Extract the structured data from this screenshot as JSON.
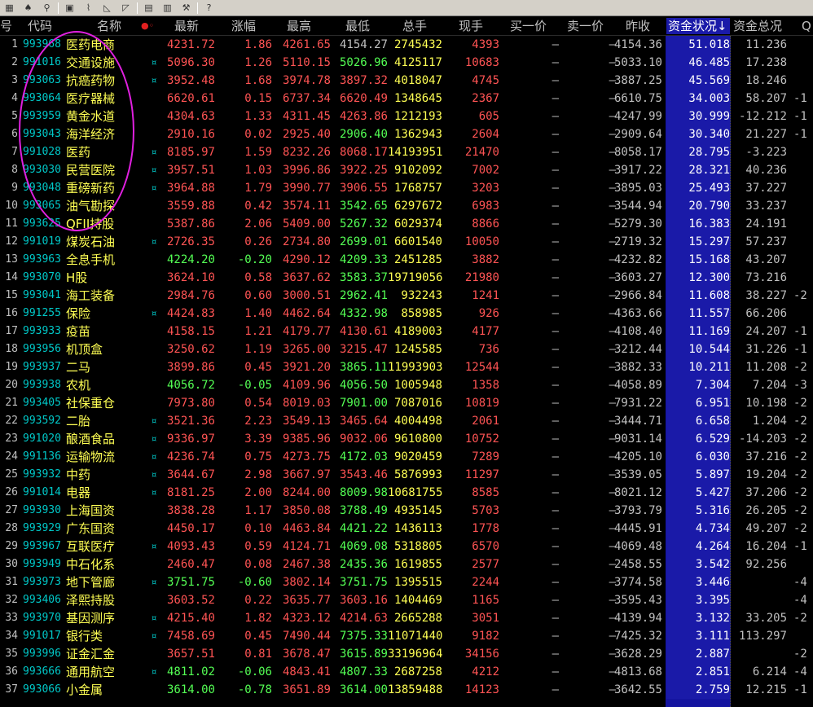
{
  "toolbar": {
    "buttons": [
      {
        "name": "layout-icon",
        "glyph": "▦"
      },
      {
        "name": "bell-icon",
        "glyph": "♠"
      },
      {
        "name": "link-icon",
        "glyph": "⚲"
      },
      {
        "name": "chart-red-icon",
        "glyph": "▣"
      },
      {
        "name": "line-chart-icon",
        "glyph": "⌇"
      },
      {
        "name": "ruler-icon",
        "glyph": "◺"
      },
      {
        "name": "angle-icon",
        "glyph": "◸"
      },
      {
        "name": "document-icon",
        "glyph": "▤"
      },
      {
        "name": "grid-icon",
        "glyph": "▥"
      },
      {
        "name": "tools-icon",
        "glyph": "⚒"
      },
      {
        "name": "help-icon",
        "glyph": "?"
      }
    ]
  },
  "header": {
    "idx": "号",
    "code": "代码",
    "name": "名称",
    "markers": "●◦",
    "latest": "最新",
    "chg": "涨幅",
    "high": "最高",
    "low": "最低",
    "vol": "总手",
    "cur": "现手",
    "bid": "买一价",
    "ask": "卖一价",
    "prev": "昨收",
    "fund": "资金状况↓",
    "total": "资金总况",
    "q": "Q"
  },
  "rows": [
    {
      "idx": "1",
      "code": "993968",
      "name": "医药电商",
      "mark": "",
      "latest": "4231.72",
      "chg": "1.86",
      "high": "4261.65",
      "low": "4154.27",
      "vol": "2745432",
      "cur": "4393",
      "bid": "—",
      "ask": "—",
      "prev": "4154.36",
      "fund": "51.018",
      "total": "11.236",
      "q": "",
      "dir": "up",
      "highDir": "up",
      "lowDir": "flat"
    },
    {
      "idx": "2",
      "code": "991016",
      "name": "交通设施",
      "mark": "¤",
      "latest": "5096.30",
      "chg": "1.26",
      "high": "5110.15",
      "low": "5026.96",
      "vol": "4125117",
      "cur": "10683",
      "bid": "—",
      "ask": "—",
      "prev": "5033.10",
      "fund": "46.485",
      "total": "17.238",
      "q": "",
      "dir": "up",
      "highDir": "up",
      "lowDir": "dn"
    },
    {
      "idx": "3",
      "code": "993063",
      "name": "抗癌药物",
      "mark": "¤",
      "latest": "3952.48",
      "chg": "1.68",
      "high": "3974.78",
      "low": "3897.32",
      "vol": "4018047",
      "cur": "4745",
      "bid": "—",
      "ask": "—",
      "prev": "3887.25",
      "fund": "45.569",
      "total": "18.246",
      "q": "",
      "dir": "up",
      "highDir": "up",
      "lowDir": "up"
    },
    {
      "idx": "4",
      "code": "993064",
      "name": "医疗器械",
      "mark": "",
      "latest": "6620.61",
      "chg": "0.15",
      "high": "6737.34",
      "low": "6620.49",
      "vol": "1348645",
      "cur": "2367",
      "bid": "—",
      "ask": "—",
      "prev": "6610.75",
      "fund": "34.003",
      "total": "58.207",
      "q": "-1",
      "dir": "up",
      "highDir": "up",
      "lowDir": "up"
    },
    {
      "idx": "5",
      "code": "993959",
      "name": "黄金水道",
      "mark": "",
      "latest": "4304.63",
      "chg": "1.33",
      "high": "4311.45",
      "low": "4263.86",
      "vol": "1212193",
      "cur": "605",
      "bid": "—",
      "ask": "—",
      "prev": "4247.99",
      "fund": "30.999",
      "total": "-12.212",
      "q": "-1",
      "dir": "up",
      "highDir": "up",
      "lowDir": "up"
    },
    {
      "idx": "6",
      "code": "993043",
      "name": "海洋经济",
      "mark": "",
      "latest": "2910.16",
      "chg": "0.02",
      "high": "2925.40",
      "low": "2906.40",
      "vol": "1362943",
      "cur": "2604",
      "bid": "—",
      "ask": "—",
      "prev": "2909.64",
      "fund": "30.340",
      "total": "21.227",
      "q": "-1",
      "dir": "up",
      "highDir": "up",
      "lowDir": "dn"
    },
    {
      "idx": "7",
      "code": "991028",
      "name": "医药",
      "mark": "¤",
      "latest": "8185.97",
      "chg": "1.59",
      "high": "8232.26",
      "low": "8068.17",
      "vol": "14193951",
      "cur": "21470",
      "bid": "—",
      "ask": "—",
      "prev": "8058.17",
      "fund": "28.795",
      "total": "-3.223",
      "q": "",
      "dir": "up",
      "highDir": "up",
      "lowDir": "up"
    },
    {
      "idx": "8",
      "code": "993030",
      "name": "民营医院",
      "mark": "¤",
      "latest": "3957.51",
      "chg": "1.03",
      "high": "3996.86",
      "low": "3922.25",
      "vol": "9102092",
      "cur": "7002",
      "bid": "—",
      "ask": "—",
      "prev": "3917.22",
      "fund": "28.321",
      "total": "40.236",
      "q": "",
      "dir": "up",
      "highDir": "up",
      "lowDir": "up"
    },
    {
      "idx": "9",
      "code": "993048",
      "name": "重磅新药",
      "mark": "¤",
      "latest": "3964.88",
      "chg": "1.79",
      "high": "3990.77",
      "low": "3906.55",
      "vol": "1768757",
      "cur": "3203",
      "bid": "—",
      "ask": "—",
      "prev": "3895.03",
      "fund": "25.493",
      "total": "37.227",
      "q": "",
      "dir": "up",
      "highDir": "up",
      "lowDir": "up"
    },
    {
      "idx": "10",
      "code": "993065",
      "name": "油气勘探",
      "mark": "",
      "latest": "3559.88",
      "chg": "0.42",
      "high": "3574.11",
      "low": "3542.65",
      "vol": "6297672",
      "cur": "6983",
      "bid": "—",
      "ask": "—",
      "prev": "3544.94",
      "fund": "20.790",
      "total": "33.237",
      "q": "",
      "dir": "up",
      "highDir": "up",
      "lowDir": "dn"
    },
    {
      "idx": "11",
      "code": "993625",
      "name": "QFII持股",
      "mark": "",
      "latest": "5387.86",
      "chg": "2.06",
      "high": "5409.00",
      "low": "5267.32",
      "vol": "6029374",
      "cur": "8866",
      "bid": "—",
      "ask": "—",
      "prev": "5279.30",
      "fund": "16.383",
      "total": "24.191",
      "q": "",
      "dir": "up",
      "highDir": "up",
      "lowDir": "dn"
    },
    {
      "idx": "12",
      "code": "991019",
      "name": "煤炭石油",
      "mark": "¤",
      "latest": "2726.35",
      "chg": "0.26",
      "high": "2734.80",
      "low": "2699.01",
      "vol": "6601540",
      "cur": "10050",
      "bid": "—",
      "ask": "—",
      "prev": "2719.32",
      "fund": "15.297",
      "total": "57.237",
      "q": "",
      "dir": "up",
      "highDir": "up",
      "lowDir": "dn"
    },
    {
      "idx": "13",
      "code": "993963",
      "name": "全息手机",
      "mark": "",
      "latest": "4224.20",
      "chg": "-0.20",
      "high": "4290.12",
      "low": "4209.33",
      "vol": "2451285",
      "cur": "3882",
      "bid": "—",
      "ask": "—",
      "prev": "4232.82",
      "fund": "15.168",
      "total": "43.207",
      "q": "",
      "dir": "dn",
      "highDir": "up",
      "lowDir": "dn"
    },
    {
      "idx": "14",
      "code": "993070",
      "name": "H股",
      "mark": "",
      "latest": "3624.10",
      "chg": "0.58",
      "high": "3637.62",
      "low": "3583.37",
      "vol": "19719056",
      "cur": "21980",
      "bid": "—",
      "ask": "—",
      "prev": "3603.27",
      "fund": "12.300",
      "total": "73.216",
      "q": "",
      "dir": "up",
      "highDir": "up",
      "lowDir": "dn"
    },
    {
      "idx": "15",
      "code": "993041",
      "name": "海工装备",
      "mark": "",
      "latest": "2984.76",
      "chg": "0.60",
      "high": "3000.51",
      "low": "2962.41",
      "vol": "932243",
      "cur": "1241",
      "bid": "—",
      "ask": "—",
      "prev": "2966.84",
      "fund": "11.608",
      "total": "38.227",
      "q": "-2",
      "dir": "up",
      "highDir": "up",
      "lowDir": "dn"
    },
    {
      "idx": "16",
      "code": "991255",
      "name": "保险",
      "mark": "¤",
      "latest": "4424.83",
      "chg": "1.40",
      "high": "4462.64",
      "low": "4332.98",
      "vol": "858985",
      "cur": "926",
      "bid": "—",
      "ask": "—",
      "prev": "4363.66",
      "fund": "11.557",
      "total": "66.206",
      "q": "",
      "dir": "up",
      "highDir": "up",
      "lowDir": "dn"
    },
    {
      "idx": "17",
      "code": "993933",
      "name": "疫苗",
      "mark": "",
      "latest": "4158.15",
      "chg": "1.21",
      "high": "4179.77",
      "low": "4130.61",
      "vol": "4189003",
      "cur": "4177",
      "bid": "—",
      "ask": "—",
      "prev": "4108.40",
      "fund": "11.169",
      "total": "24.207",
      "q": "-1",
      "dir": "up",
      "highDir": "up",
      "lowDir": "up"
    },
    {
      "idx": "18",
      "code": "993956",
      "name": "机顶盒",
      "mark": "",
      "latest": "3250.62",
      "chg": "1.19",
      "high": "3265.00",
      "low": "3215.47",
      "vol": "1245585",
      "cur": "736",
      "bid": "—",
      "ask": "—",
      "prev": "3212.44",
      "fund": "10.544",
      "total": "31.226",
      "q": "-1",
      "dir": "up",
      "highDir": "up",
      "lowDir": "up"
    },
    {
      "idx": "19",
      "code": "993937",
      "name": "二马",
      "mark": "",
      "latest": "3899.86",
      "chg": "0.45",
      "high": "3921.20",
      "low": "3865.11",
      "vol": "11993903",
      "cur": "12544",
      "bid": "—",
      "ask": "—",
      "prev": "3882.33",
      "fund": "10.211",
      "total": "11.208",
      "q": "-2",
      "dir": "up",
      "highDir": "up",
      "lowDir": "dn"
    },
    {
      "idx": "20",
      "code": "993938",
      "name": "农机",
      "mark": "",
      "latest": "4056.72",
      "chg": "-0.05",
      "high": "4109.96",
      "low": "4056.50",
      "vol": "1005948",
      "cur": "1358",
      "bid": "—",
      "ask": "—",
      "prev": "4058.89",
      "fund": "7.304",
      "total": "7.204",
      "q": "-3",
      "dir": "dn",
      "highDir": "up",
      "lowDir": "dn"
    },
    {
      "idx": "21",
      "code": "993405",
      "name": "社保重仓",
      "mark": "",
      "latest": "7973.80",
      "chg": "0.54",
      "high": "8019.03",
      "low": "7901.00",
      "vol": "7087016",
      "cur": "10819",
      "bid": "—",
      "ask": "—",
      "prev": "7931.22",
      "fund": "6.951",
      "total": "10.198",
      "q": "-2",
      "dir": "up",
      "highDir": "up",
      "lowDir": "dn"
    },
    {
      "idx": "22",
      "code": "993592",
      "name": "二胎",
      "mark": "¤",
      "latest": "3521.36",
      "chg": "2.23",
      "high": "3549.13",
      "low": "3465.64",
      "vol": "4004498",
      "cur": "2061",
      "bid": "—",
      "ask": "—",
      "prev": "3444.71",
      "fund": "6.658",
      "total": "1.204",
      "q": "-2",
      "dir": "up",
      "highDir": "up",
      "lowDir": "up"
    },
    {
      "idx": "23",
      "code": "991020",
      "name": "酿酒食品",
      "mark": "¤",
      "latest": "9336.97",
      "chg": "3.39",
      "high": "9385.96",
      "low": "9032.06",
      "vol": "9610800",
      "cur": "10752",
      "bid": "—",
      "ask": "—",
      "prev": "9031.14",
      "fund": "6.529",
      "total": "-14.203",
      "q": "-2",
      "dir": "up",
      "highDir": "up",
      "lowDir": "up"
    },
    {
      "idx": "24",
      "code": "991136",
      "name": "运输物流",
      "mark": "¤",
      "latest": "4236.74",
      "chg": "0.75",
      "high": "4273.75",
      "low": "4172.03",
      "vol": "9020459",
      "cur": "7289",
      "bid": "—",
      "ask": "—",
      "prev": "4205.10",
      "fund": "6.030",
      "total": "37.216",
      "q": "-2",
      "dir": "up",
      "highDir": "up",
      "lowDir": "dn"
    },
    {
      "idx": "25",
      "code": "993932",
      "name": "中药",
      "mark": "¤",
      "latest": "3644.67",
      "chg": "2.98",
      "high": "3667.97",
      "low": "3543.46",
      "vol": "5876993",
      "cur": "11297",
      "bid": "—",
      "ask": "—",
      "prev": "3539.05",
      "fund": "5.897",
      "total": "19.204",
      "q": "-2",
      "dir": "up",
      "highDir": "up",
      "lowDir": "up"
    },
    {
      "idx": "26",
      "code": "991014",
      "name": "电器",
      "mark": "¤",
      "latest": "8181.25",
      "chg": "2.00",
      "high": "8244.00",
      "low": "8009.98",
      "vol": "10681755",
      "cur": "8585",
      "bid": "—",
      "ask": "—",
      "prev": "8021.12",
      "fund": "5.427",
      "total": "37.206",
      "q": "-2",
      "dir": "up",
      "highDir": "up",
      "lowDir": "dn"
    },
    {
      "idx": "27",
      "code": "993930",
      "name": "上海国资",
      "mark": "",
      "latest": "3838.28",
      "chg": "1.17",
      "high": "3850.08",
      "low": "3788.49",
      "vol": "4935145",
      "cur": "5703",
      "bid": "—",
      "ask": "—",
      "prev": "3793.79",
      "fund": "5.316",
      "total": "26.205",
      "q": "-2",
      "dir": "up",
      "highDir": "up",
      "lowDir": "dn"
    },
    {
      "idx": "28",
      "code": "993929",
      "name": "广东国资",
      "mark": "",
      "latest": "4450.17",
      "chg": "0.10",
      "high": "4463.84",
      "low": "4421.22",
      "vol": "1436113",
      "cur": "1778",
      "bid": "—",
      "ask": "—",
      "prev": "4445.91",
      "fund": "4.734",
      "total": "49.207",
      "q": "-2",
      "dir": "up",
      "highDir": "up",
      "lowDir": "dn"
    },
    {
      "idx": "29",
      "code": "993967",
      "name": "互联医疗",
      "mark": "¤",
      "latest": "4093.43",
      "chg": "0.59",
      "high": "4124.71",
      "low": "4069.08",
      "vol": "5318805",
      "cur": "6570",
      "bid": "—",
      "ask": "—",
      "prev": "4069.48",
      "fund": "4.264",
      "total": "16.204",
      "q": "-1",
      "dir": "up",
      "highDir": "up",
      "lowDir": "dn"
    },
    {
      "idx": "30",
      "code": "993949",
      "name": "中石化系",
      "mark": "",
      "latest": "2460.47",
      "chg": "0.08",
      "high": "2467.38",
      "low": "2435.36",
      "vol": "1619855",
      "cur": "2577",
      "bid": "—",
      "ask": "—",
      "prev": "2458.55",
      "fund": "3.542",
      "total": "92.256",
      "q": "",
      "dir": "up",
      "highDir": "up",
      "lowDir": "dn"
    },
    {
      "idx": "31",
      "code": "993973",
      "name": "地下管廊",
      "mark": "¤",
      "latest": "3751.75",
      "chg": "-0.60",
      "high": "3802.14",
      "low": "3751.75",
      "vol": "1395515",
      "cur": "2244",
      "bid": "—",
      "ask": "—",
      "prev": "3774.58",
      "fund": "3.446",
      "total": "",
      "q": "-4",
      "dir": "dn",
      "highDir": "up",
      "lowDir": "dn"
    },
    {
      "idx": "32",
      "code": "993406",
      "name": "泽熙持股",
      "mark": "",
      "latest": "3603.52",
      "chg": "0.22",
      "high": "3635.77",
      "low": "3603.16",
      "vol": "1404469",
      "cur": "1165",
      "bid": "—",
      "ask": "—",
      "prev": "3595.43",
      "fund": "3.395",
      "total": "",
      "q": "-4",
      "dir": "up",
      "highDir": "up",
      "lowDir": "up"
    },
    {
      "idx": "33",
      "code": "993970",
      "name": "基因测序",
      "mark": "¤",
      "latest": "4215.40",
      "chg": "1.82",
      "high": "4323.12",
      "low": "4214.63",
      "vol": "2665288",
      "cur": "3051",
      "bid": "—",
      "ask": "—",
      "prev": "4139.94",
      "fund": "3.132",
      "total": "33.205",
      "q": "-2",
      "dir": "up",
      "highDir": "up",
      "lowDir": "up"
    },
    {
      "idx": "34",
      "code": "991017",
      "name": "银行类",
      "mark": "¤",
      "latest": "7458.69",
      "chg": "0.45",
      "high": "7490.44",
      "low": "7375.33",
      "vol": "11071440",
      "cur": "9182",
      "bid": "—",
      "ask": "—",
      "prev": "7425.32",
      "fund": "3.111",
      "total": "113.297",
      "q": "",
      "dir": "up",
      "highDir": "up",
      "lowDir": "dn"
    },
    {
      "idx": "35",
      "code": "993996",
      "name": "证金汇金",
      "mark": "",
      "latest": "3657.51",
      "chg": "0.81",
      "high": "3678.47",
      "low": "3615.89",
      "vol": "33196964",
      "cur": "34156",
      "bid": "—",
      "ask": "—",
      "prev": "3628.29",
      "fund": "2.887",
      "total": "",
      "q": "-2",
      "dir": "up",
      "highDir": "up",
      "lowDir": "dn"
    },
    {
      "idx": "36",
      "code": "993666",
      "name": "通用航空",
      "mark": "¤",
      "latest": "4811.02",
      "chg": "-0.06",
      "high": "4843.41",
      "low": "4807.33",
      "vol": "2687258",
      "cur": "4212",
      "bid": "—",
      "ask": "—",
      "prev": "4813.68",
      "fund": "2.851",
      "total": "6.214",
      "q": "-4",
      "dir": "dn",
      "highDir": "up",
      "lowDir": "dn"
    },
    {
      "idx": "37",
      "code": "993066",
      "name": "小金属",
      "mark": "",
      "latest": "3614.00",
      "chg": "-0.78",
      "high": "3651.89",
      "low": "3614.00",
      "vol": "13859488",
      "cur": "14123",
      "bid": "—",
      "ask": "—",
      "prev": "3642.55",
      "fund": "2.759",
      "total": "12.215",
      "q": "-1",
      "dir": "dn",
      "highDir": "up",
      "lowDir": "dn"
    }
  ]
}
